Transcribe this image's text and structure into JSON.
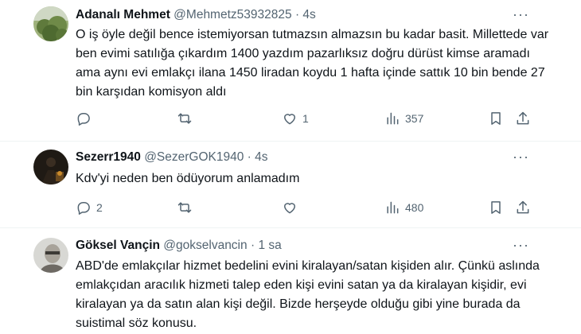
{
  "tweets": [
    {
      "name": "Adanalı Mehmet",
      "handle": "@Mehmetz53932825",
      "dot": "·",
      "time": "4s",
      "more": "···",
      "text": "O iş öyle değil bence istemiyorsan tutmazsın almazsın bu kadar basit. Millettede var ben evimi satılığa çıkardım 1400 yazdım pazarlıksız doğru dürüst kimse aramadı ama aynı evi emlakçı ilana 1450 liradan koydu 1 hafta içinde sattık 10 bin bende 27 bin karşıdan komisyon aldı",
      "replies": "",
      "retweets": "",
      "likes": "1",
      "views": "357"
    },
    {
      "name": "Sezerr1940",
      "handle": "@SezerGOK1940",
      "dot": "·",
      "time": "4s",
      "more": "···",
      "text": "Kdv'yi neden ben ödüyorum anlamadım",
      "replies": "2",
      "retweets": "",
      "likes": "",
      "views": "480"
    },
    {
      "name": "Göksel Vançin",
      "handle": "@gokselvancin",
      "dot": "·",
      "time": "1 sa",
      "more": "···",
      "text": "ABD'de emlakçılar hizmet bedelini evini kiralayan/satan kişiden alır. Çünkü aslında emlakçıdan aracılık hizmeti talep eden kişi evini satan ya da kiralayan kişidir, evi kiralayan ya da satın alan kişi değil. Bizde herşeyde olduğu gibi yine burada da suistimal söz konusu."
    }
  ],
  "icons": {
    "reply": "reply-icon",
    "retweet": "retweet-icon",
    "like": "heart-icon",
    "views": "views-chart-icon",
    "bookmark": "bookmark-icon",
    "share": "share-icon"
  },
  "colors": {
    "text": "#0f1419",
    "secondary": "#536471",
    "divider": "#eff3f4"
  }
}
